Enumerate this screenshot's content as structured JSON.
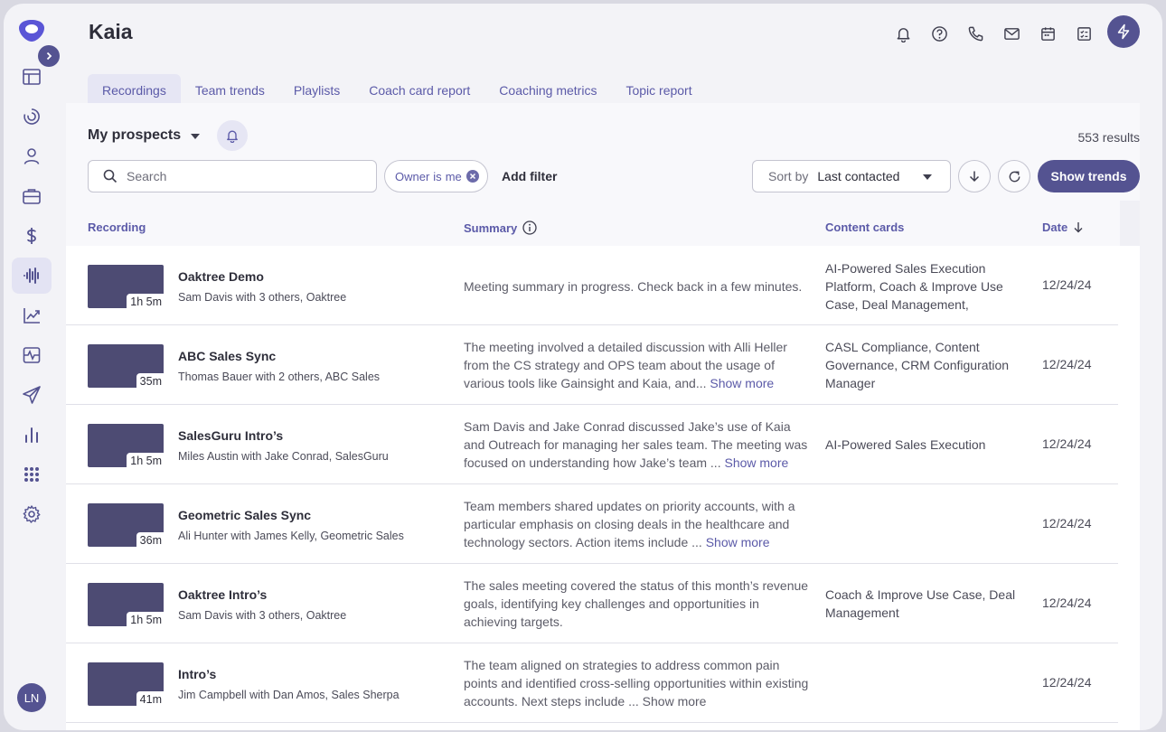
{
  "app": {
    "title": "Kaia",
    "user_initials": "LN"
  },
  "tabs": [
    {
      "label": "Recordings",
      "active": true
    },
    {
      "label": "Team trends",
      "active": false
    },
    {
      "label": "Playlists",
      "active": false
    },
    {
      "label": "Coach card report",
      "active": false
    },
    {
      "label": "Coaching metrics",
      "active": false
    },
    {
      "label": "Topic report",
      "active": false
    }
  ],
  "toolbar": {
    "view": "My prospects",
    "results": "553 results",
    "search_placeholder": "Search",
    "filter_chip": {
      "key": "Owner",
      "op": "is",
      "value": "me"
    },
    "add_filter": "Add filter",
    "sort_label": "Sort by",
    "sort_value": "Last contacted",
    "show_trends": "Show trends"
  },
  "table": {
    "headers": {
      "recording": "Recording",
      "summary": "Summary",
      "content_cards": "Content cards",
      "date": "Date"
    },
    "rows": [
      {
        "title": "Oaktree Demo",
        "subtitle": "Sam Davis with 3 others, Oaktree",
        "duration": "1h 5m",
        "summary": "Meeting summary in progress. Check back in a few minutes.",
        "show_more": "",
        "cards": "AI-Powered Sales Execution Platform, Coach & Improve Use Case, Deal Management,",
        "date": "12/24/24"
      },
      {
        "title": "ABC Sales Sync",
        "subtitle": "Thomas Bauer with 2 others, ABC Sales",
        "duration": "35m",
        "summary": "The meeting involved a detailed discussion with Alli Heller from the CS strategy and OPS team about the usage of various tools like Gainsight and Kaia, and...",
        "show_more": "Show more",
        "cards": "CASL Compliance, Content Governance, CRM Configuration Manager",
        "date": "12/24/24"
      },
      {
        "title": "SalesGuru Intro’s",
        "subtitle": "Miles Austin with Jake Conrad, SalesGuru",
        "duration": "1h 5m",
        "summary": "Sam Davis and Jake Conrad discussed Jake’s use of Kaia and Outreach for managing her sales team. The meeting was focused on understanding how Jake’s team ...",
        "show_more": "Show more",
        "cards": "AI-Powered Sales Execution",
        "date": "12/24/24"
      },
      {
        "title": "Geometric Sales Sync",
        "subtitle": "Ali Hunter with James Kelly, Geometric Sales",
        "duration": "36m",
        "summary": "Team members shared updates on priority accounts, with a particular emphasis on closing deals in the healthcare and technology sectors. Action items include ...",
        "show_more": "Show more",
        "cards": "",
        "date": "12/24/24"
      },
      {
        "title": "Oaktree Intro’s",
        "subtitle": "Sam Davis with 3 others, Oaktree",
        "duration": "1h 5m",
        "summary": "The sales meeting covered the status of this month’s revenue goals, identifying key challenges and opportunities in achieving targets.",
        "show_more": "",
        "cards": "Coach & Improve Use Case, Deal Management",
        "date": "12/24/24"
      },
      {
        "title": "Intro’s",
        "subtitle": "Jim Campbell with Dan Amos, Sales Sherpa",
        "duration": "41m",
        "summary": "The team aligned on strategies to address common pain points and identified cross-selling opportunities within existing accounts. Next steps include ...",
        "show_more": "Show more",
        "cards": "",
        "date": "12/24/24"
      }
    ]
  },
  "colors": {
    "accent": "#545391",
    "link": "#5b5aa8",
    "thumb": "#4d4b73"
  }
}
